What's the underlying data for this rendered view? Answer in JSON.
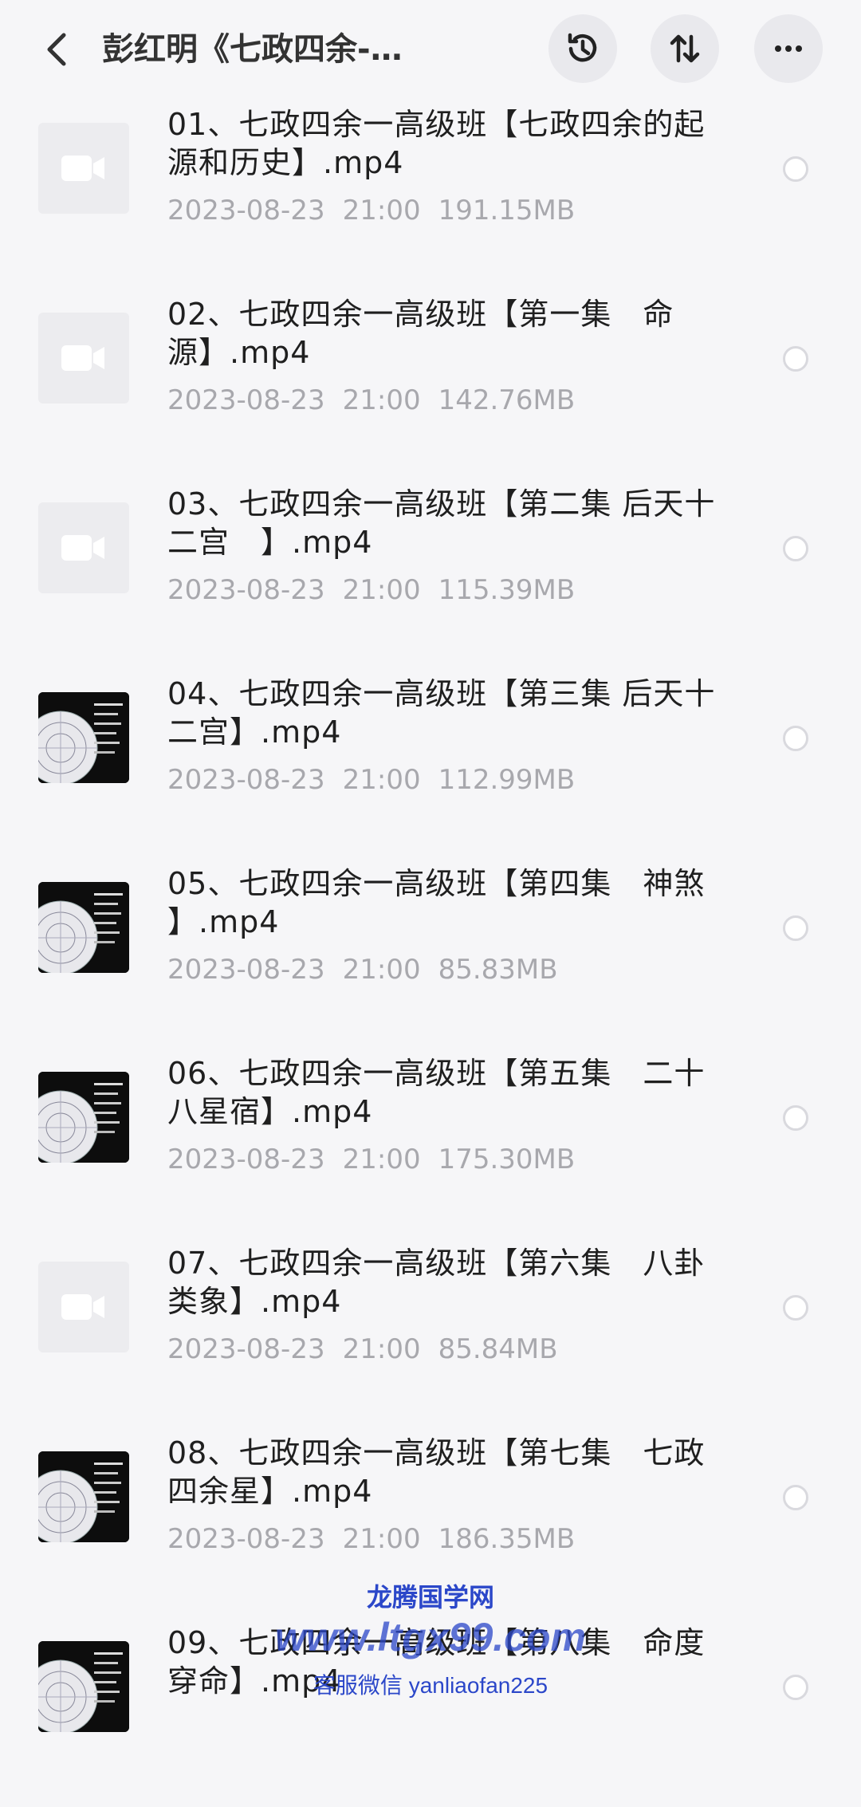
{
  "header": {
    "title": "彭红明《七政四余-…",
    "back_icon": "chevron-left-icon",
    "history_icon": "history-icon",
    "sort_icon": "sort-icon",
    "more_icon": "more-icon"
  },
  "files": [
    {
      "name": "01、七政四余一高级班【七政四余的起源和历史】.mp4",
      "date": "2023-08-23",
      "time": "21:00",
      "size": "191.15MB",
      "thumb": "placeholder"
    },
    {
      "name": "02、七政四余一高级班【第一集　命源】.mp4",
      "date": "2023-08-23",
      "time": "21:00",
      "size": "142.76MB",
      "thumb": "placeholder"
    },
    {
      "name": "03、七政四余一高级班【第二集 后天十二宫　】.mp4",
      "date": "2023-08-23",
      "time": "21:00",
      "size": "115.39MB",
      "thumb": "placeholder"
    },
    {
      "name": "04、七政四余一高级班【第三集 后天十二宫】.mp4",
      "date": "2023-08-23",
      "time": "21:00",
      "size": "112.99MB",
      "thumb": "image"
    },
    {
      "name": "05、七政四余一高级班【第四集　神煞 】.mp4",
      "date": "2023-08-23",
      "time": "21:00",
      "size": "85.83MB",
      "thumb": "image"
    },
    {
      "name": "06、七政四余一高级班【第五集　二十八星宿】.mp4",
      "date": "2023-08-23",
      "time": "21:00",
      "size": "175.30MB",
      "thumb": "image"
    },
    {
      "name": "07、七政四余一高级班【第六集　八卦类象】.mp4",
      "date": "2023-08-23",
      "time": "21:00",
      "size": "85.84MB",
      "thumb": "placeholder"
    },
    {
      "name": "08、七政四余一高级班【第七集　七政四余星】.mp4",
      "date": "2023-08-23",
      "time": "21:00",
      "size": "186.35MB",
      "thumb": "image"
    },
    {
      "name": "09、七政四余一高级班【第八集　命度 穿命】.mp4",
      "date": "",
      "time": "",
      "size": "",
      "thumb": "image"
    }
  ],
  "watermark": {
    "line1": "龙腾国学网",
    "line2": "www.ltgx99.com",
    "line3": "客服微信 yanliaofan225"
  },
  "colors": {
    "background": "#f6f6f8",
    "meta_text": "#a8a8ad",
    "watermark": "#2b47c9"
  }
}
